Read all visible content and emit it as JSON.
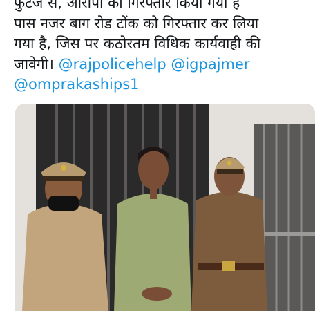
{
  "tweet": {
    "text_lines": [
      "फुटेज से, आरोपी को गिरफ्तार किया गया है",
      "पास नजर बाग रोड टोंक को गिरफ्तार कर लिया",
      "गया है, जिस पर कठोरतम विधिक कार्यवाही की",
      "जावेगी।"
    ],
    "mentions": [
      "@rajpolicehelp",
      "@igpajmer",
      "@omprakaships1"
    ]
  },
  "colors": {
    "text": "#14171a",
    "link": "#1b95e0",
    "uniform": "#8a6a48",
    "wall": "#e4e1dc"
  }
}
